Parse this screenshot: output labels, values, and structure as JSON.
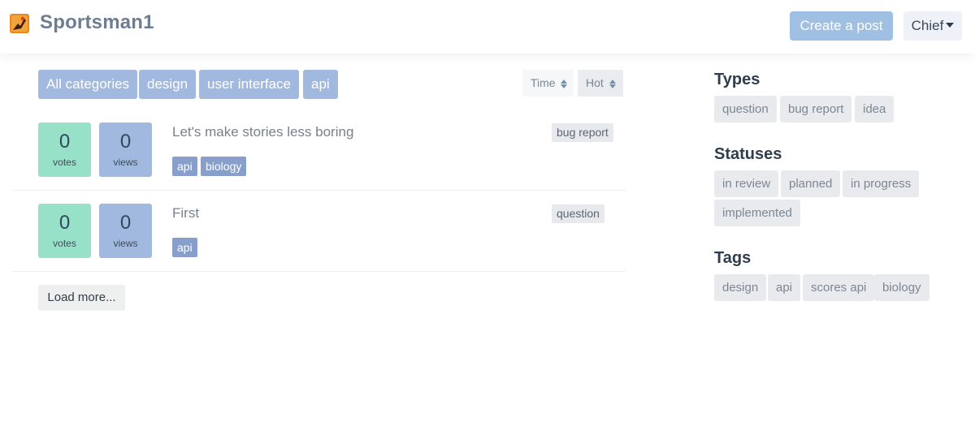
{
  "header": {
    "site_title": "Sportsman1",
    "create_post_label": "Create a post",
    "user_menu_label": "Chief"
  },
  "filters": {
    "categories": [
      "All categories",
      "design",
      "user interface",
      "api"
    ],
    "sort_time_label": "Time",
    "sort_hot_label": "Hot"
  },
  "posts": [
    {
      "votes": "0",
      "votes_label": "votes",
      "views": "0",
      "views_label": "views",
      "title": "Let's make stories less boring",
      "type": "bug report",
      "tags": [
        "api",
        "biology"
      ]
    },
    {
      "votes": "0",
      "votes_label": "votes",
      "views": "0",
      "views_label": "views",
      "title": "First",
      "type": "question",
      "tags": [
        "api"
      ]
    }
  ],
  "load_more_label": "Load more...",
  "sidebar": {
    "types_heading": "Types",
    "types": [
      "question",
      "bug report",
      "idea"
    ],
    "statuses_heading": "Statuses",
    "statuses": [
      "in review",
      "planned",
      "in progress",
      "implemented"
    ],
    "tags_heading": "Tags",
    "tags": [
      "design",
      "api",
      "scores api",
      "biology"
    ]
  },
  "colors": {
    "accent": "#a1b9de",
    "votes_bg": "#98e1c9",
    "tag_bg": "#889fcb",
    "primary_button": "#9fc0e3"
  }
}
